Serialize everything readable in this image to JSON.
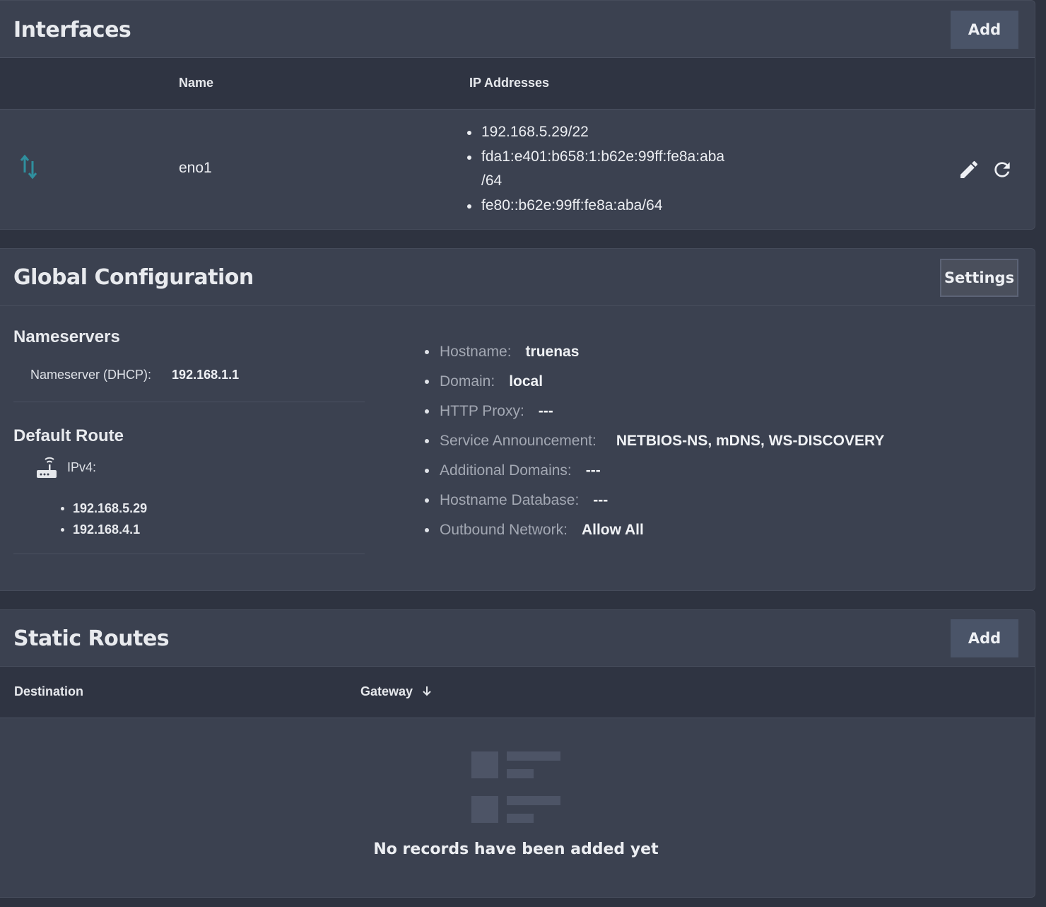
{
  "interfaces": {
    "title": "Interfaces",
    "add_label": "Add",
    "columns": {
      "name": "Name",
      "ip": "IP Addresses"
    },
    "rows": [
      {
        "name": "eno1",
        "ips": [
          "192.168.5.29/22",
          "fda1:e401:b658:1:b62e:99ff:fe8a:aba",
          "/64",
          "fe80::b62e:99ff:fe8a:aba/64"
        ],
        "status_icon": "network-activity-icon",
        "actions": [
          "edit-icon",
          "reset-icon"
        ]
      }
    ]
  },
  "global": {
    "title": "Global Configuration",
    "settings_label": "Settings",
    "nameservers": {
      "heading": "Nameservers",
      "label": "Nameserver (DHCP):",
      "value": "192.168.1.1"
    },
    "default_route": {
      "heading": "Default Route",
      "icon": "router-icon",
      "label": "IPv4:",
      "gateways": [
        "192.168.5.29",
        "192.168.4.1"
      ]
    },
    "info": [
      {
        "label": "Hostname:",
        "value": "truenas"
      },
      {
        "label": "Domain:",
        "value": "local"
      },
      {
        "label": "HTTP Proxy:",
        "value": "---"
      },
      {
        "label": "Service Announcement:",
        "value": "NETBIOS-NS, mDNS, WS-DISCOVERY"
      },
      {
        "label": "Additional Domains:",
        "value": "---"
      },
      {
        "label": "Hostname Database:",
        "value": "---"
      },
      {
        "label": "Outbound Network:",
        "value": "Allow All"
      }
    ]
  },
  "static_routes": {
    "title": "Static Routes",
    "add_label": "Add",
    "columns": {
      "destination": "Destination",
      "gateway": "Gateway"
    },
    "sort_icon": "arrow-down-icon",
    "empty_icon": "empty-list-icon",
    "empty_text": "No records have been added yet"
  },
  "colors": {
    "background": "#2e3340",
    "card": "#3b4150",
    "table_header": "#2f3442",
    "button": "#4a5468",
    "status_icon": "#2f8f9e"
  }
}
